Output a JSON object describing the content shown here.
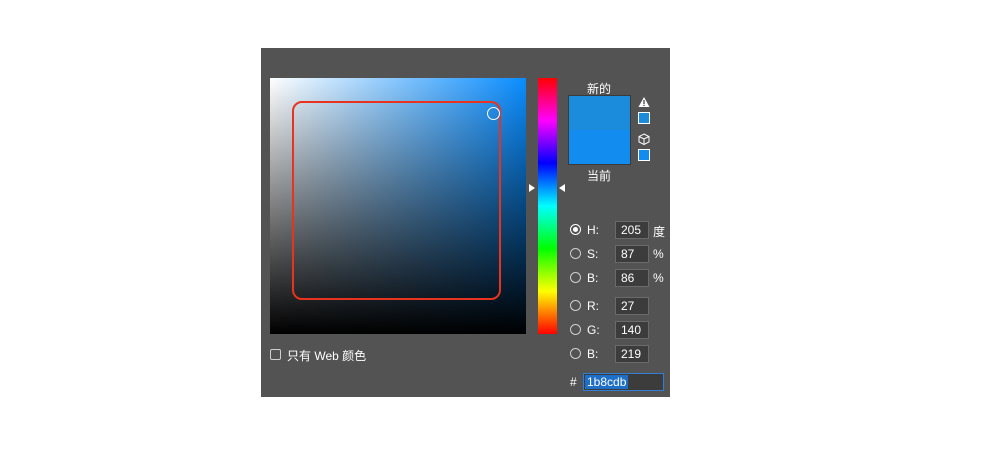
{
  "color_picker": {
    "swatch_new_label": "新的",
    "swatch_current_label": "当前",
    "new_color": "#1b8cdb",
    "current_color": "#138cf0",
    "highlight_color": "#e8331f",
    "hsb": {
      "h_label": "H:",
      "h_value": "205",
      "h_unit": "度",
      "s_label": "S:",
      "s_value": "87",
      "s_unit": "%",
      "b_label": "B:",
      "b_value": "86",
      "b_unit": "%"
    },
    "rgb": {
      "r_label": "R:",
      "r_value": "27",
      "g_label": "G:",
      "g_value": "140",
      "b_label": "B:",
      "b_value": "219"
    },
    "hex_label": "#",
    "hex_value": "1b8cdb",
    "web_only_label": "只有 Web 颜色",
    "selected_mode": "H"
  }
}
